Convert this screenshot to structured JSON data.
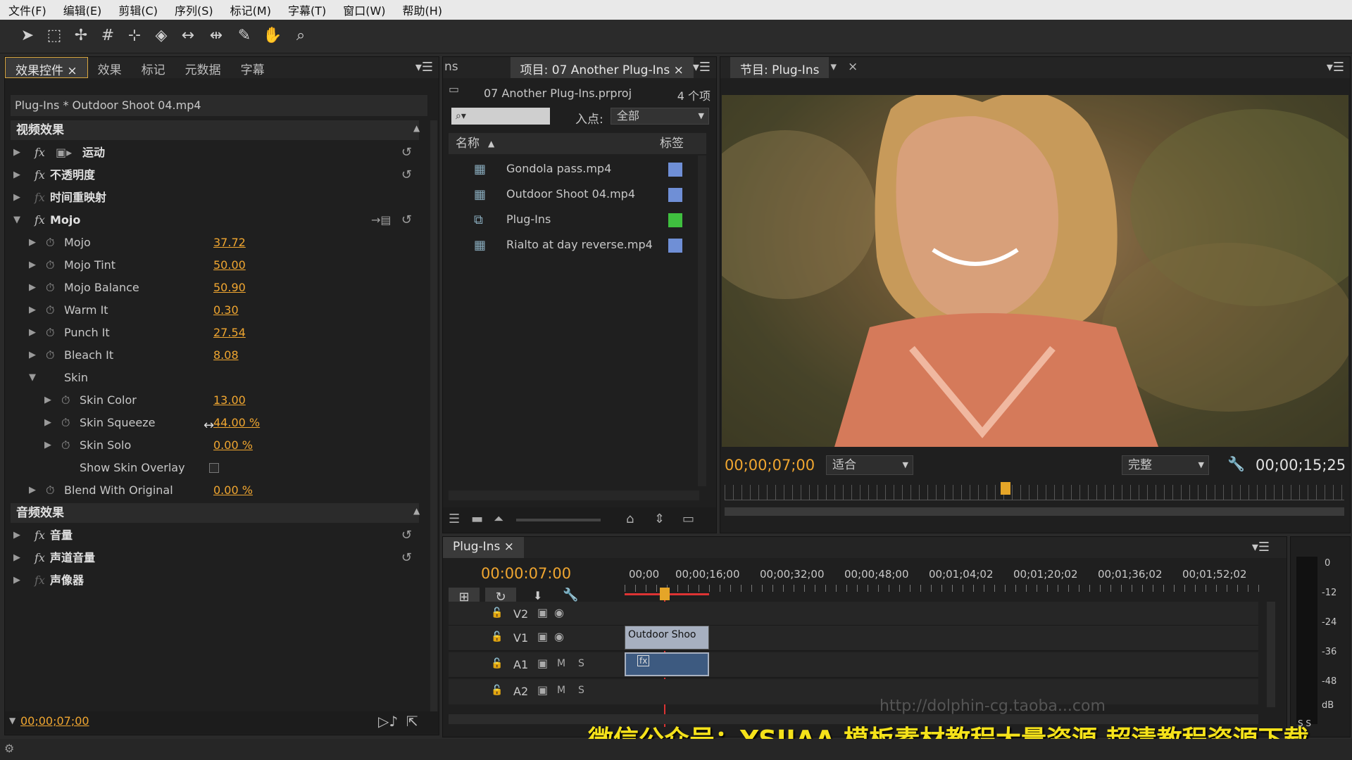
{
  "menu": [
    "文件(F)",
    "编辑(E)",
    "剪辑(C)",
    "序列(S)",
    "标记(M)",
    "字幕(T)",
    "窗口(W)",
    "帮助(H)"
  ],
  "effect_controls": {
    "tabs": [
      "效果控件 ×",
      "效果",
      "标记",
      "元数据",
      "字幕"
    ],
    "clip": "Plug-Ins * Outdoor Shoot 04.mp4",
    "video_section": "视频效果",
    "audio_section": "音频效果",
    "video_effects": [
      "运动",
      "不透明度",
      "时间重映射",
      "Mojo"
    ],
    "params": [
      {
        "label": "Mojo",
        "value": "37.72"
      },
      {
        "label": "Mojo Tint",
        "value": "50.00"
      },
      {
        "label": "Mojo Balance",
        "value": "50.90"
      },
      {
        "label": "Warm It",
        "value": "0.30"
      },
      {
        "label": "Punch It",
        "value": "27.54"
      },
      {
        "label": "Bleach It",
        "value": "8.08"
      }
    ],
    "skin_label": "Skin",
    "skin_params": [
      {
        "label": "Skin Color",
        "value": "13.00"
      },
      {
        "label": "Skin Squeeze",
        "value": "44.00 %"
      },
      {
        "label": "Skin Solo",
        "value": "0.00 %"
      }
    ],
    "overlay_label": "Show Skin Overlay",
    "blend": {
      "label": "Blend With Original",
      "value": "0.00 %"
    },
    "audio_effects": [
      "音量",
      "声道音量",
      "声像器"
    ],
    "timecode": "00;00;07;00"
  },
  "project": {
    "left_tab": "ns",
    "tab": "项目: 07 Another Plug-Ins ×",
    "file": "07 Another Plug-Ins.prproj",
    "count": "4 个项",
    "inpoint_label": "入点:",
    "inpoint_value": "全部",
    "col_name": "名称",
    "col_label": "标签",
    "items": [
      {
        "name": "Gondola pass.mp4",
        "color": "#6f8fd6"
      },
      {
        "name": "Outdoor Shoot 04.mp4",
        "color": "#6f8fd6"
      },
      {
        "name": "Plug-Ins",
        "color": "#3fbf3f"
      },
      {
        "name": "Rialto at day reverse.mp4",
        "color": "#6f8fd6"
      }
    ]
  },
  "program": {
    "tab": "节目: Plug-Ins",
    "timecode": "00;00;07;00",
    "fit": "适合",
    "quality": "完整",
    "duration": "00;00;15;25"
  },
  "timeline": {
    "tab": "Plug-Ins ×",
    "timecode": "00:00:07:00",
    "ruler": [
      "00;00",
      "00;00;16;00",
      "00;00;32;00",
      "00;00;48;00",
      "00;01;04;02",
      "00;01;20;02",
      "00;01;36;02",
      "00;01;52;02"
    ],
    "tracks": [
      "V2",
      "V1",
      "A1",
      "A2"
    ],
    "clip_label": "Outdoor Shoo",
    "meter_labels": [
      "0",
      "-12",
      "-24",
      "-36",
      "-48",
      "dB"
    ],
    "meter_bottom": "S S"
  },
  "watermark": "微信公众号：YSJJAA 模板素材教程大量资源 超清教程资源下载",
  "url_overlay": "http://dolphin-cg.taoba...com"
}
